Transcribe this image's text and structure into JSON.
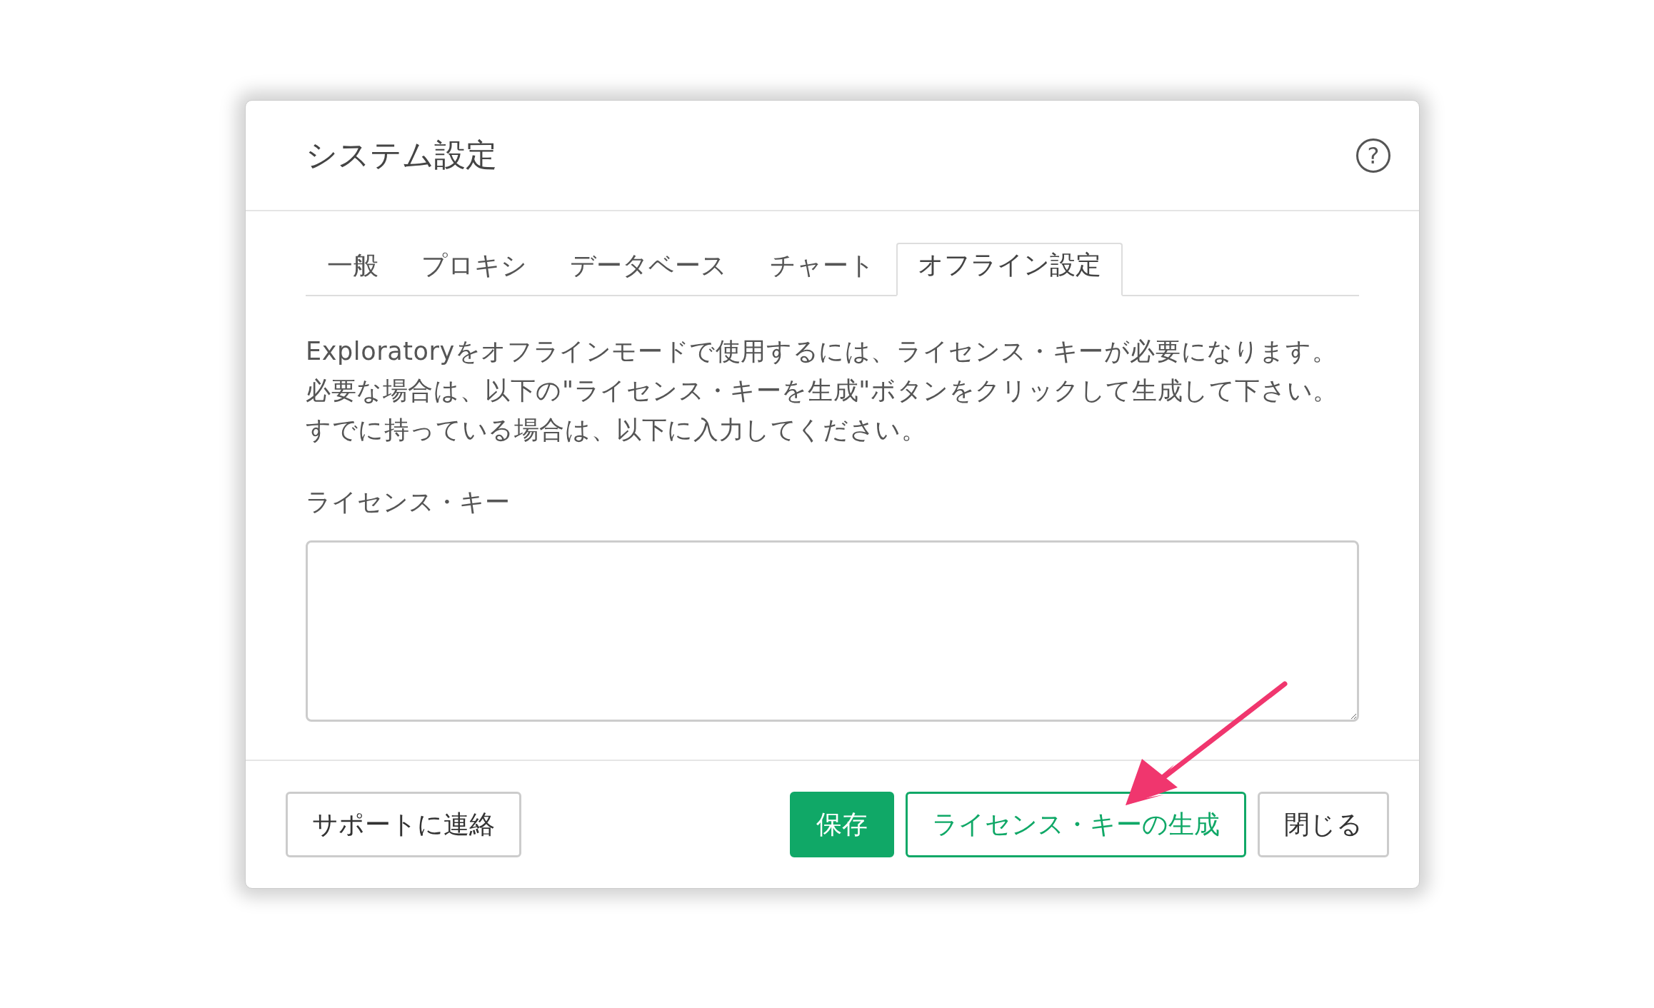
{
  "dialog": {
    "title": "システム設定",
    "help_icon": "?"
  },
  "tabs": [
    {
      "label": "一般",
      "selected": false
    },
    {
      "label": "プロキシ",
      "selected": false
    },
    {
      "label": "データベース",
      "selected": false
    },
    {
      "label": "チャート",
      "selected": false
    },
    {
      "label": "オフライン設定",
      "selected": true
    }
  ],
  "description": "Exploratoryをオフラインモードで使用するには、ライセンス・キーが必要になります。必要な場合は、以下の\"ライセンス・キーを生成\"ボタンをクリックして生成して下さい。すでに持っている場合は、以下に入力してください。",
  "license_key": {
    "label": "ライセンス・キー"
  },
  "footer": {
    "buttons": [
      {
        "label": "サポートに連絡",
        "kind": "default"
      },
      {
        "label": "保存",
        "kind": "primary"
      },
      {
        "label": "ライセンス・キーの生成",
        "kind": "outline"
      },
      {
        "label": "閉じる",
        "kind": "default"
      }
    ]
  }
}
